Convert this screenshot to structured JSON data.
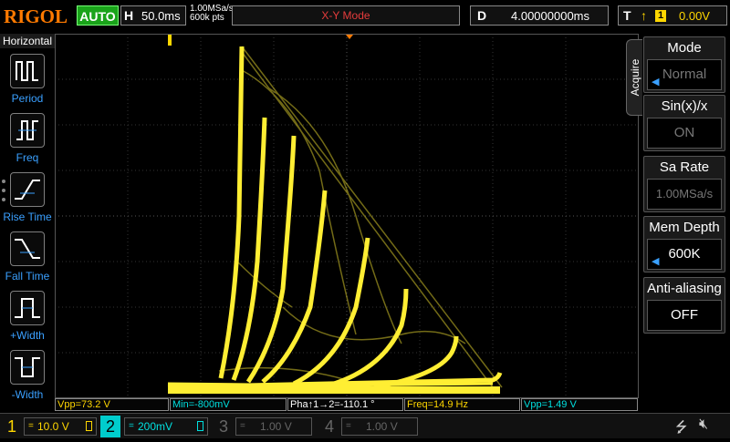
{
  "header": {
    "logo": "RIGOL",
    "run_status": "AUTO",
    "horizontal": {
      "label": "H",
      "timebase": "50.0ms"
    },
    "sampling": {
      "rate": "1.00MSa/s",
      "points": "600k pts"
    },
    "mode": "X-Y Mode",
    "delay": {
      "label": "D",
      "value": "4.00000000ms"
    },
    "trigger": {
      "label": "T",
      "edge_icon": "rising-edge-icon",
      "source": "1",
      "level": "0.00V"
    }
  },
  "left_panel": {
    "title": "Horizontal",
    "items": [
      {
        "label": "Period",
        "icon": "period-icon"
      },
      {
        "label": "Freq",
        "icon": "freq-icon"
      },
      {
        "label": "Rise Time",
        "icon": "rise-time-icon"
      },
      {
        "label": "Fall Time",
        "icon": "fall-time-icon"
      },
      {
        "label": "+Width",
        "icon": "pos-width-icon"
      },
      {
        "label": "-Width",
        "icon": "neg-width-icon"
      }
    ]
  },
  "right_menu": {
    "tab": "Acquire",
    "items": [
      {
        "title": "Mode",
        "value": "Normal"
      },
      {
        "title": "Sin(x)/x",
        "value": "ON"
      },
      {
        "title": "Sa Rate",
        "value": "1.00MSa/s"
      },
      {
        "title": "Mem Depth",
        "value": "600K"
      },
      {
        "title": "Anti-aliasing",
        "value": "OFF"
      }
    ]
  },
  "measurements": [
    {
      "text": "Vpp=73.2 V",
      "color": "#ffd700"
    },
    {
      "text": "Min=-800mV",
      "color": "#00e0e0"
    },
    {
      "text": "Pha↑1→2=-110.1 °",
      "color": "#ffffff"
    },
    {
      "text": "Freq=14.9 Hz",
      "color": "#ffd700"
    },
    {
      "text": "Vpp=1.49 V",
      "color": "#00e0e0"
    }
  ],
  "channels": [
    {
      "num": "1",
      "coupling": "=",
      "value": "10.0 V",
      "color": "#ffd700"
    },
    {
      "num": "2",
      "coupling": "=",
      "value": "200mV",
      "color": "#00e0e0"
    },
    {
      "num": "3",
      "coupling": "=",
      "value": "1.00 V",
      "color": "#666666"
    },
    {
      "num": "4",
      "coupling": "=",
      "value": "1.00 V",
      "color": "#666666"
    }
  ],
  "colors": {
    "trace": "#ffee33",
    "accent": "#ff7a00"
  }
}
